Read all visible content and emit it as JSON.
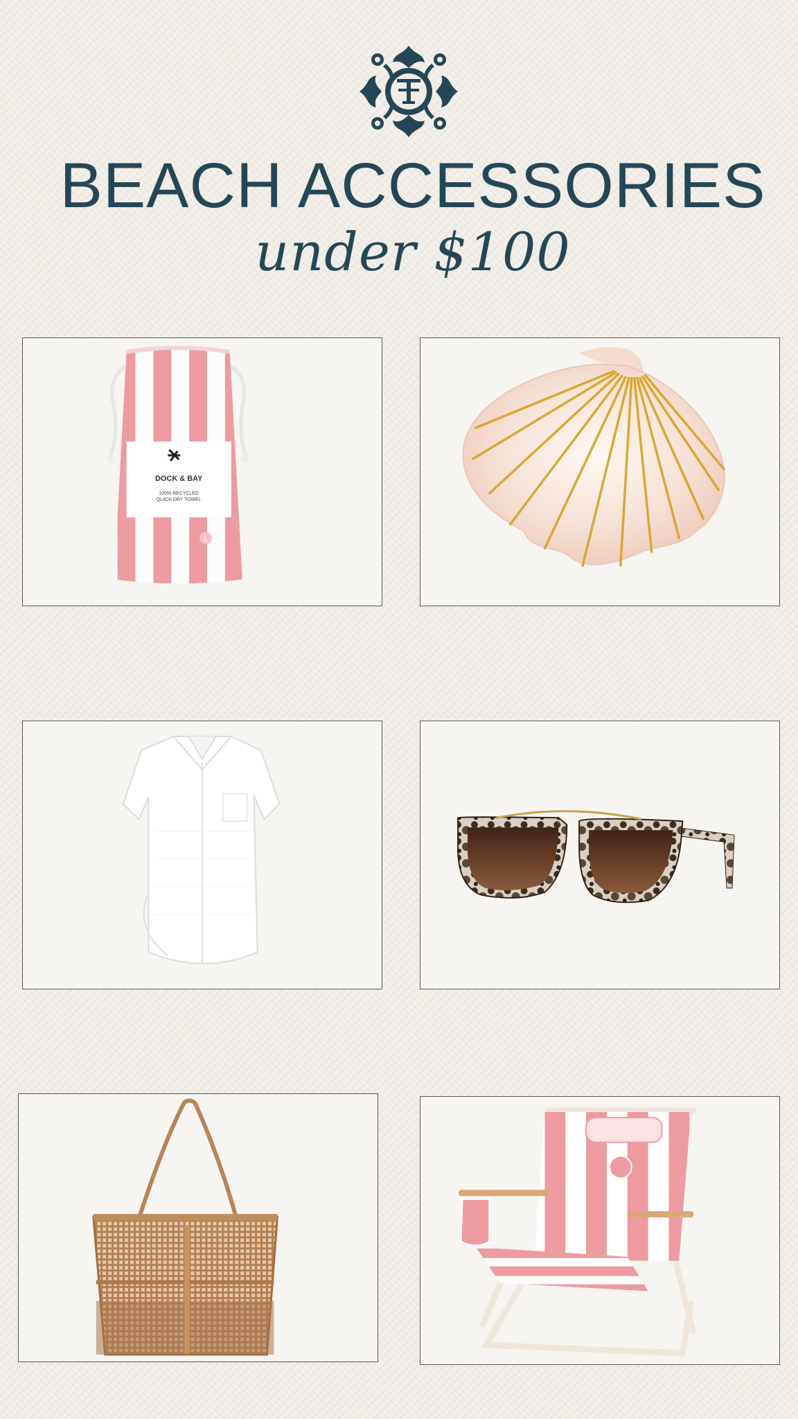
{
  "header": {
    "title": "BEACH ACCESSORIES",
    "subtitle": "under $100",
    "logo_icon": "tt-monogram-icon"
  },
  "products": [
    {
      "name": "towel-pouch",
      "brand_text": "DOCK & BAY",
      "detail_line1": "100% RECYCLED",
      "detail_line2": "QUICK DRY TOWEL",
      "size_badge": "L",
      "icon": "striped-towel-pouch-icon"
    },
    {
      "name": "shell-hair-claw",
      "icon": "seashell-claw-clip-icon"
    },
    {
      "name": "white-shirt-dress",
      "icon": "shirt-dress-icon"
    },
    {
      "name": "tortoise-sunglasses",
      "icon": "sunglasses-icon"
    },
    {
      "name": "mesh-tote-bag",
      "icon": "mesh-tote-icon"
    },
    {
      "name": "striped-beach-chair",
      "icon": "beach-chair-icon"
    }
  ],
  "colors": {
    "navy": "#254755",
    "pink_stripe": "#ee9aa1",
    "gold": "#d9a82e",
    "tote_tan": "#b57f4f",
    "lens_brown": "#5b3524",
    "card_bg": "#f7f5f2",
    "page_bg": "#f0ece6"
  }
}
